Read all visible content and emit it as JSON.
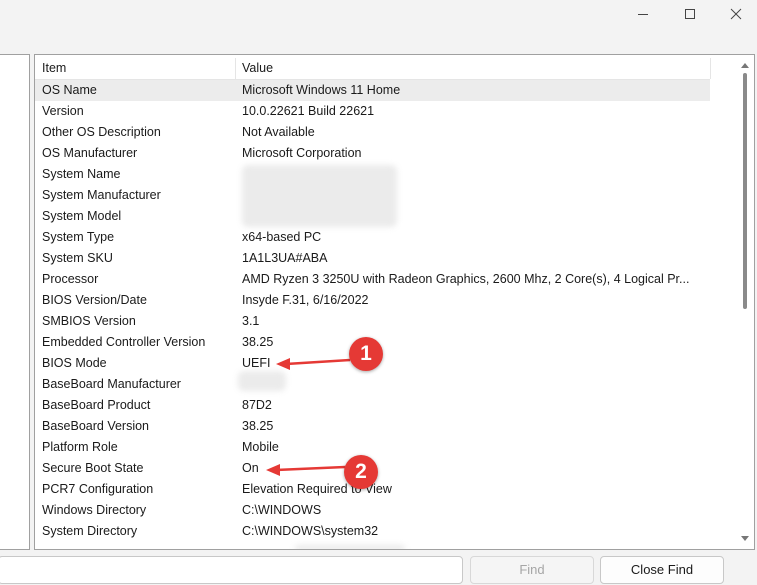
{
  "window": {
    "controls": {
      "minimize_icon": "minimize-icon",
      "maximize_icon": "maximize-icon",
      "close_icon": "close-icon"
    }
  },
  "table": {
    "headers": {
      "item": "Item",
      "value": "Value"
    },
    "rows": [
      {
        "item": "OS Name",
        "value": "Microsoft Windows 11 Home",
        "selected": true
      },
      {
        "item": "Version",
        "value": "10.0.22621 Build 22621"
      },
      {
        "item": "Other OS Description",
        "value": "Not Available"
      },
      {
        "item": "OS Manufacturer",
        "value": "Microsoft Corporation"
      },
      {
        "item": "System Name",
        "value": ""
      },
      {
        "item": "System Manufacturer",
        "value": ""
      },
      {
        "item": "System Model",
        "value": ""
      },
      {
        "item": "System Type",
        "value": "x64-based PC"
      },
      {
        "item": "System SKU",
        "value": "1A1L3UA#ABA"
      },
      {
        "item": "Processor",
        "value": "AMD Ryzen 3 3250U with Radeon Graphics, 2600 Mhz, 2 Core(s), 4 Logical Pr..."
      },
      {
        "item": "BIOS Version/Date",
        "value": "Insyde F.31, 6/16/2022"
      },
      {
        "item": "SMBIOS Version",
        "value": "3.1"
      },
      {
        "item": "Embedded Controller Version",
        "value": "38.25"
      },
      {
        "item": "BIOS Mode",
        "value": "UEFI"
      },
      {
        "item": "BaseBoard Manufacturer",
        "value": ""
      },
      {
        "item": "BaseBoard Product",
        "value": "87D2"
      },
      {
        "item": "BaseBoard Version",
        "value": "38.25"
      },
      {
        "item": "Platform Role",
        "value": "Mobile"
      },
      {
        "item": "Secure Boot State",
        "value": "On"
      },
      {
        "item": "PCR7 Configuration",
        "value": "Elevation Required to View"
      },
      {
        "item": "Windows Directory",
        "value": "C:\\WINDOWS"
      },
      {
        "item": "System Directory",
        "value": "C:\\WINDOWS\\system32"
      }
    ]
  },
  "find_bar": {
    "find_value": "",
    "find_button": "Find",
    "close_find_button": "Close Find"
  },
  "annotations": {
    "badge_1": "1",
    "badge_2": "2",
    "color": "#e53935"
  }
}
